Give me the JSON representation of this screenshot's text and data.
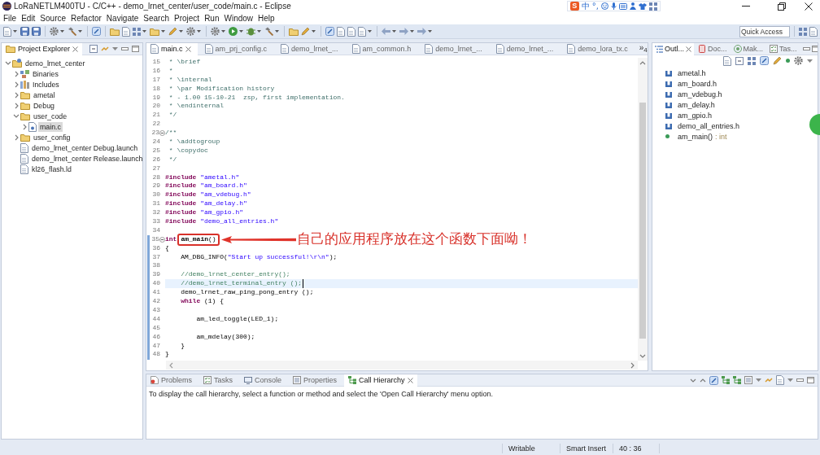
{
  "window": {
    "title": "LoRaNETLM400TU - C/C++ - demo_lrnet_center/user_code/main.c - Eclipse"
  },
  "ime_bar": {
    "logo": "S",
    "mode": "中",
    "punctuation": "°,"
  },
  "menu": [
    "File",
    "Edit",
    "Source",
    "Refactor",
    "Navigate",
    "Search",
    "Project",
    "Run",
    "Window",
    "Help"
  ],
  "quick_access": {
    "placeholder": "Quick Access"
  },
  "project_explorer": {
    "title": "Project Explorer",
    "tree": [
      {
        "label": "demo_lrnet_center",
        "kind": "project",
        "expanded": true,
        "selected": false,
        "children": [
          {
            "label": "Binaries",
            "kind": "binaries",
            "expanded": false,
            "selected": false
          },
          {
            "label": "Includes",
            "kind": "includes",
            "expanded": false,
            "selected": false
          },
          {
            "label": "ametal",
            "kind": "folder",
            "expanded": false,
            "selected": false
          },
          {
            "label": "Debug",
            "kind": "folder",
            "expanded": false,
            "selected": false
          },
          {
            "label": "user_code",
            "kind": "folder",
            "expanded": true,
            "selected": false,
            "children": [
              {
                "label": "main.c",
                "kind": "source",
                "expanded": false,
                "selected": true
              }
            ]
          },
          {
            "label": "user_config",
            "kind": "folder",
            "expanded": false,
            "selected": false
          },
          {
            "label": "demo_lrnet_center Debug.launch",
            "kind": "file",
            "selected": false
          },
          {
            "label": "demo_lrnet_center Release.launch",
            "kind": "file",
            "selected": false
          },
          {
            "label": "kl26_flash.ld",
            "kind": "file",
            "selected": false
          }
        ]
      }
    ]
  },
  "editor": {
    "tabs": [
      {
        "label": "main.c",
        "selected": true
      },
      {
        "label": "am_prj_config.c",
        "selected": false
      },
      {
        "label": "demo_lrnet_...",
        "selected": false
      },
      {
        "label": "am_common.h",
        "selected": false
      },
      {
        "label": "demo_lrnet_...",
        "selected": false
      },
      {
        "label": "demo_lrnet_...",
        "selected": false
      },
      {
        "label": "demo_lora_tx.c",
        "selected": false
      }
    ],
    "more_tabs": {
      "glyph": "»",
      "count": "4"
    },
    "blocks": [
      {
        "marked": false,
        "lines": [
          {
            "number": "15",
            "fold": false,
            "current": false,
            "tokens": [
              {
                "kind": "doc",
                "text": " * \\brief"
              }
            ]
          },
          {
            "number": "16",
            "fold": false,
            "current": false,
            "tokens": [
              {
                "kind": "doc",
                "text": " *"
              }
            ]
          },
          {
            "number": "17",
            "fold": false,
            "current": false,
            "tokens": [
              {
                "kind": "doc",
                "text": " * \\internal"
              }
            ]
          },
          {
            "number": "18",
            "fold": false,
            "current": false,
            "tokens": [
              {
                "kind": "doc",
                "text": " * \\par Modification history"
              }
            ]
          },
          {
            "number": "19",
            "fold": false,
            "current": false,
            "tokens": [
              {
                "kind": "doc",
                "text": " * - 1.00 15-10-21  zsp, first implementation."
              }
            ]
          },
          {
            "number": "20",
            "fold": false,
            "current": false,
            "tokens": [
              {
                "kind": "doc",
                "text": " * \\endinternal"
              }
            ]
          },
          {
            "number": "21",
            "fold": false,
            "current": false,
            "tokens": [
              {
                "kind": "doc",
                "text": " */"
              }
            ]
          },
          {
            "number": "22",
            "fold": false,
            "current": false
          },
          {
            "number": "23",
            "fold": true,
            "current": false,
            "tokens": [
              {
                "kind": "doc",
                "text": "/**"
              }
            ]
          },
          {
            "number": "24",
            "fold": false,
            "current": false,
            "tokens": [
              {
                "kind": "doc",
                "text": " * \\addtogroup"
              }
            ]
          },
          {
            "number": "25",
            "fold": false,
            "current": false,
            "tokens": [
              {
                "kind": "doc",
                "text": " * \\copydoc"
              }
            ]
          },
          {
            "number": "26",
            "fold": false,
            "current": false,
            "tokens": [
              {
                "kind": "doc",
                "text": " */"
              }
            ]
          },
          {
            "number": "27",
            "fold": false,
            "current": false
          },
          {
            "number": "28",
            "fold": false,
            "current": false,
            "tokens": [
              {
                "kind": "keyword",
                "text": "#include"
              },
              {
                "kind": "string",
                "text": " \"ametal.h\""
              }
            ]
          },
          {
            "number": "29",
            "fold": false,
            "current": false,
            "tokens": [
              {
                "kind": "keyword",
                "text": "#include"
              },
              {
                "kind": "string",
                "text": " \"am_board.h\""
              }
            ]
          },
          {
            "number": "30",
            "fold": false,
            "current": false,
            "tokens": [
              {
                "kind": "keyword",
                "text": "#include"
              },
              {
                "kind": "string",
                "text": " \"am_vdebug.h\""
              }
            ]
          },
          {
            "number": "31",
            "fold": false,
            "current": false,
            "tokens": [
              {
                "kind": "keyword",
                "text": "#include"
              },
              {
                "kind": "string",
                "text": " \"am_delay.h\""
              }
            ]
          },
          {
            "number": "32",
            "fold": false,
            "current": false,
            "tokens": [
              {
                "kind": "keyword",
                "text": "#include"
              },
              {
                "kind": "string",
                "text": " \"am_gpio.h\""
              }
            ]
          },
          {
            "number": "33",
            "fold": false,
            "current": false,
            "tokens": [
              {
                "kind": "keyword",
                "text": "#include"
              },
              {
                "kind": "string",
                "text": " \"demo_all_entries.h\""
              }
            ]
          },
          {
            "number": "34",
            "fold": false,
            "current": false
          }
        ]
      },
      {
        "marked": true,
        "lines": [
          {
            "number": "35",
            "fold": true,
            "current": false,
            "tokens": [
              {
                "kind": "keyword",
                "text": "int"
              }
            ],
            "callout": {
              "tokens": [
                {
                  "kind": "decl",
                  "text": "am_main"
                },
                {
                  "kind": "plain",
                  "text": "()"
                }
              ],
              "note": "自己的应用程序放在这个函数下面呦！"
            }
          },
          {
            "number": "36",
            "fold": false,
            "current": false,
            "tokens": [
              {
                "kind": "plain",
                "text": "{"
              }
            ]
          },
          {
            "number": "37",
            "fold": false,
            "current": false,
            "tokens": [
              {
                "kind": "plain",
                "text": "    AM_DBG_INFO("
              },
              {
                "kind": "string",
                "text": "\"Start up successful!\\r\\n\""
              },
              {
                "kind": "plain",
                "text": ");"
              }
            ]
          },
          {
            "number": "38",
            "fold": false,
            "current": false
          },
          {
            "number": "39",
            "fold": false,
            "current": false,
            "tokens": [
              {
                "kind": "comment",
                "text": "    //demo_lrnet_center_entry();"
              }
            ]
          },
          {
            "number": "40",
            "fold": false,
            "current": true,
            "tokens": [
              {
                "kind": "comment",
                "text": "    //demo_lrnet_terminal_entry ();"
              }
            ]
          },
          {
            "number": "41",
            "fold": false,
            "current": false,
            "tokens": [
              {
                "kind": "plain",
                "text": "    demo_lrnet_raw_ping_pong_entry ();"
              }
            ]
          },
          {
            "number": "42",
            "fold": false,
            "current": false,
            "tokens": [
              {
                "kind": "keyword",
                "text": "    while"
              },
              {
                "kind": "plain",
                "text": " (1) {"
              }
            ]
          },
          {
            "number": "43",
            "fold": false,
            "current": false
          },
          {
            "number": "44",
            "fold": false,
            "current": false,
            "tokens": [
              {
                "kind": "plain",
                "text": "        am_led_toggle(LED_1);"
              }
            ]
          },
          {
            "number": "45",
            "fold": false,
            "current": false
          },
          {
            "number": "46",
            "fold": false,
            "current": false,
            "tokens": [
              {
                "kind": "plain",
                "text": "        am_mdelay(300);"
              }
            ]
          },
          {
            "number": "47",
            "fold": false,
            "current": false,
            "tokens": [
              {
                "kind": "plain",
                "text": "    }"
              }
            ]
          },
          {
            "number": "48",
            "fold": false,
            "current": false,
            "tokens": [
              {
                "kind": "plain",
                "text": "}"
              }
            ]
          }
        ]
      }
    ]
  },
  "outline": {
    "tabs": [
      {
        "label": "Outl...",
        "selected": true
      },
      {
        "label": "Doc...",
        "selected": false
      },
      {
        "label": "Mak...",
        "selected": false
      },
      {
        "label": "Tas...",
        "selected": false
      }
    ],
    "items": [
      {
        "kind": "include",
        "label": "ametal.h"
      },
      {
        "kind": "include",
        "label": "am_board.h"
      },
      {
        "kind": "include",
        "label": "am_vdebug.h"
      },
      {
        "kind": "include",
        "label": "am_delay.h"
      },
      {
        "kind": "include",
        "label": "am_gpio.h"
      },
      {
        "kind": "include",
        "label": "demo_all_entries.h"
      },
      {
        "kind": "function",
        "label": "am_main()",
        "detail": ": int"
      }
    ]
  },
  "bottom_panel": {
    "tabs": [
      {
        "label": "Problems",
        "selected": false
      },
      {
        "label": "Tasks",
        "selected": false
      },
      {
        "label": "Console",
        "selected": false
      },
      {
        "label": "Properties",
        "selected": false
      },
      {
        "label": "Call Hierarchy",
        "selected": true
      }
    ],
    "message": "To display the call hierarchy, select a function or method and select the 'Open Call Hierarchy' menu option."
  },
  "status_bar": {
    "mode": "Writable",
    "insert_mode": "Smart Insert",
    "cursor_position": "40 : 36"
  }
}
